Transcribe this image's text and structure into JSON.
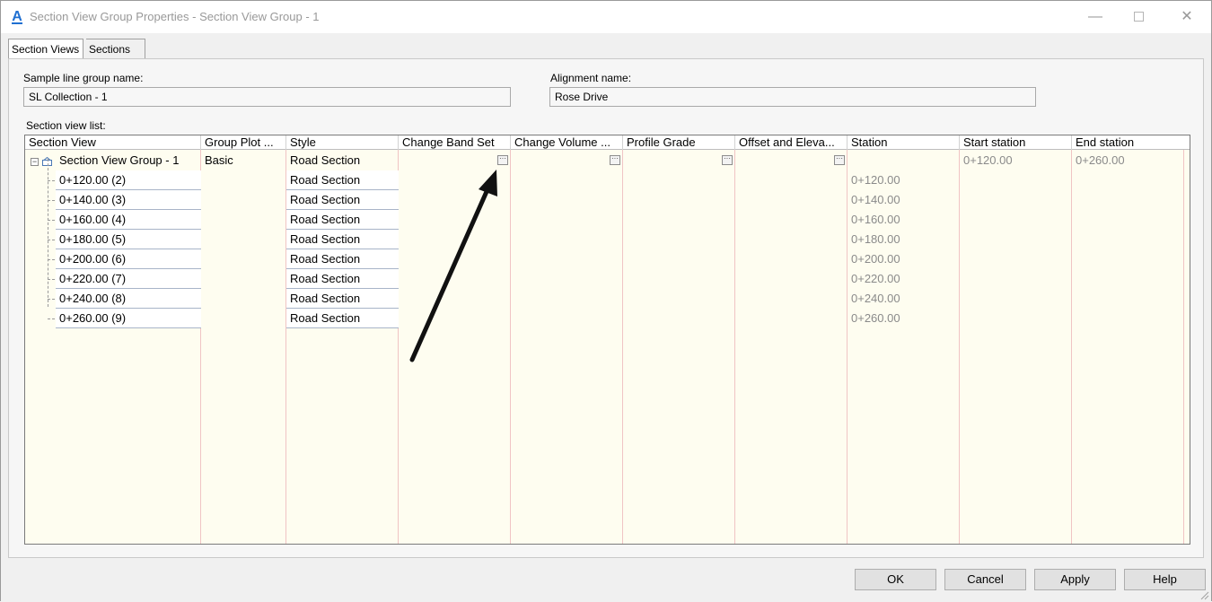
{
  "window": {
    "title": "Section View Group Properties - Section View Group - 1",
    "minimize_glyph": "—",
    "close_glyph": "✕"
  },
  "tabs": [
    {
      "label": "Section Views"
    },
    {
      "label": "Sections"
    }
  ],
  "fields": {
    "sample_line_group_label": "Sample line group name:",
    "sample_line_group_value": "SL Collection - 1",
    "alignment_label": "Alignment name:",
    "alignment_value": "Rose Drive",
    "section_view_list_label": "Section view list:"
  },
  "table": {
    "columns": [
      "Section View",
      "Group Plot ...",
      "Style",
      "Change Band Set",
      "Change Volume ...",
      "Profile Grade",
      "Offset and Eleva...",
      "Station",
      "Start station",
      "End station"
    ],
    "group_row": {
      "section_view": "Section View Group - 1",
      "group_plot": "Basic",
      "style": "Road Section",
      "start_station": "0+120.00",
      "end_station": "0+260.00",
      "ellipsis": "···"
    },
    "rows": [
      {
        "section_view": "0+120.00 (2)",
        "style": "Road Section",
        "station": "0+120.00"
      },
      {
        "section_view": "0+140.00 (3)",
        "style": "Road Section",
        "station": "0+140.00"
      },
      {
        "section_view": "0+160.00 (4)",
        "style": "Road Section",
        "station": "0+160.00"
      },
      {
        "section_view": "0+180.00 (5)",
        "style": "Road Section",
        "station": "0+180.00"
      },
      {
        "section_view": "0+200.00 (6)",
        "style": "Road Section",
        "station": "0+200.00"
      },
      {
        "section_view": "0+220.00 (7)",
        "style": "Road Section",
        "station": "0+220.00"
      },
      {
        "section_view": "0+240.00 (8)",
        "style": "Road Section",
        "station": "0+240.00"
      },
      {
        "section_view": "0+260.00 (9)",
        "style": "Road Section",
        "station": "0+260.00"
      }
    ],
    "expander_glyph": "−"
  },
  "buttons": {
    "ok": "OK",
    "cancel": "Cancel",
    "apply": "Apply",
    "help": "Help"
  },
  "icons": {
    "app": "autocad-civil3d-icon",
    "group": "section-view-group-icon",
    "arrow": "annotation-arrow"
  },
  "colors": {
    "grid_background": "#fefdf0",
    "grid_vertical_lines": "#f0c4c4",
    "app_icon": "#1f6fd1"
  }
}
